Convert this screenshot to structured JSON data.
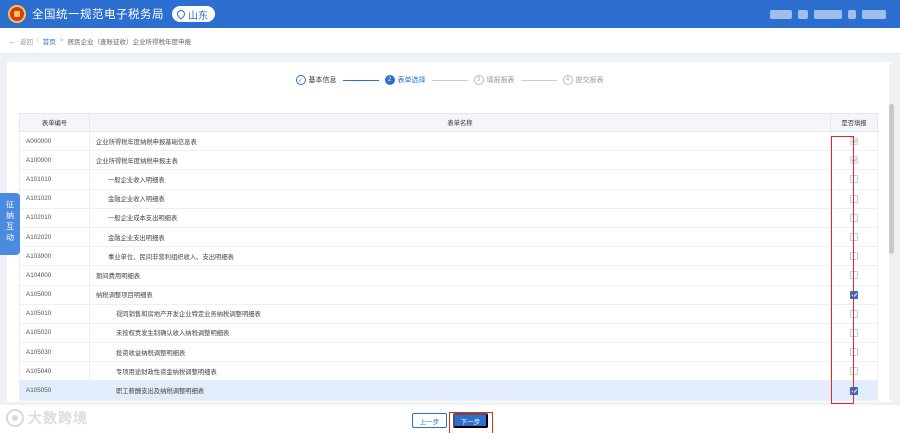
{
  "header": {
    "site_title": "全国统一规范电子税务局",
    "region": "山东"
  },
  "breadcrumb": {
    "back_label": "返回",
    "home_label": "首页",
    "current_label": "居民企业（查账征收）企业所得税年度申报"
  },
  "steps": [
    {
      "num": "✓",
      "label": "基本信息",
      "state": "done"
    },
    {
      "num": "2",
      "label": "表单选择",
      "state": "active"
    },
    {
      "num": "3",
      "label": "填报报表",
      "state": "todo"
    },
    {
      "num": "4",
      "label": "提交报表",
      "state": "todo"
    }
  ],
  "table": {
    "headers": {
      "code": "表单编号",
      "name": "表单名称",
      "fill": "是否填报"
    },
    "rows": [
      {
        "code": "A000000",
        "name": "企业所得税年度纳税申报基础信息表",
        "indent": 0,
        "state": "disabled"
      },
      {
        "code": "A100000",
        "name": "企业所得税年度纳税申报主表",
        "indent": 0,
        "state": "disabled"
      },
      {
        "code": "A101010",
        "name": "一般企业收入明细表",
        "indent": 1,
        "state": "off"
      },
      {
        "code": "A101020",
        "name": "金融企业收入明细表",
        "indent": 1,
        "state": "off"
      },
      {
        "code": "A102010",
        "name": "一般企业成本支出明细表",
        "indent": 1,
        "state": "off"
      },
      {
        "code": "A102020",
        "name": "金融企业支出明细表",
        "indent": 1,
        "state": "off"
      },
      {
        "code": "A103000",
        "name": "事业单位、民间非营利组织收入、支出明细表",
        "indent": 1,
        "state": "off"
      },
      {
        "code": "A104000",
        "name": "期间费用明细表",
        "indent": 0,
        "state": "off"
      },
      {
        "code": "A105000",
        "name": "纳税调整项目明细表",
        "indent": 0,
        "state": "on"
      },
      {
        "code": "A105010",
        "name": "视同销售和房地产开发企业特定业务纳税调整明细表",
        "indent": 2,
        "state": "off"
      },
      {
        "code": "A105020",
        "name": "未按权责发生制确认收入纳税调整明细表",
        "indent": 2,
        "state": "off"
      },
      {
        "code": "A105030",
        "name": "投资收益纳税调整明细表",
        "indent": 2,
        "state": "off"
      },
      {
        "code": "A105040",
        "name": "专项用途财政性资金纳税调整明细表",
        "indent": 2,
        "state": "off"
      },
      {
        "code": "A105050",
        "name": "职工薪酬支出及纳税调整明细表",
        "indent": 2,
        "state": "on",
        "highlight": true
      }
    ]
  },
  "side_tab": {
    "chars": [
      "征",
      "纳",
      "互",
      "动"
    ]
  },
  "footer": {
    "prev_label": "上一步",
    "next_label": "下一步"
  },
  "watermark": {
    "text": "大数跨境"
  },
  "colors": {
    "primary": "#2c6fd1",
    "annotation": "#e02a2a",
    "highlight_row": "#e2ecfb"
  }
}
